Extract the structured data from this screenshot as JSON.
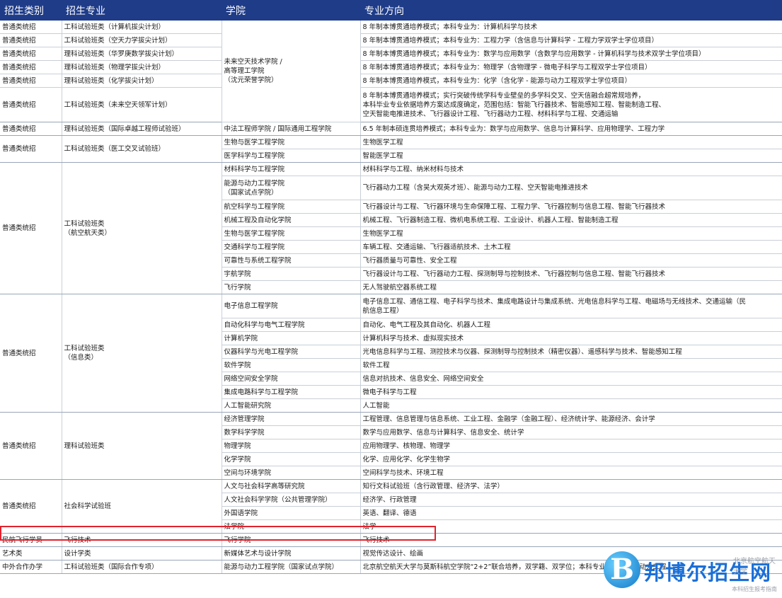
{
  "header": {
    "col1": "招生类别",
    "col2": "招生专业",
    "col3": "学院",
    "col4": "专业方向"
  },
  "rows": [
    {
      "cat": "普通类统招",
      "major": "工科试验班类（计算机拔尖计划）",
      "school": "未来空天技术学院 /\n高等理工学院\n（沈元荣誉学院）",
      "dir": "8 年制本博贯通培养模式；本科专业为：计算机科学与技术"
    },
    {
      "cat": "普通类统招",
      "major": "工科试验班类（空天力学拔尖计划）",
      "dir": "8 年制本博贯通培养模式；本科专业为：工程力学（含信息与计算科学 - 工程力学双学士学位项目）"
    },
    {
      "cat": "普通类统招",
      "major": "理科试验班类（华罗庚数学拔尖计划）",
      "dir": "8 年制本博贯通培养模式；本科专业为：数学与应用数学（含数学与应用数学 - 计算机科学与技术双学士学位项目）"
    },
    {
      "cat": "普通类统招",
      "major": "理科试验班类（物理学拔尖计划）",
      "dir": "8 年制本博贯通培养模式；本科专业为：物理学（含物理学 - 微电子科学与工程双学士学位项目）"
    },
    {
      "cat": "普通类统招",
      "major": "理科试验班类（化学拔尖计划）",
      "dir": "8 年制本博贯通培养模式，本科专业为：化学（含化学 - 能源与动力工程双学士学位项目）"
    },
    {
      "cat": "普通类统招",
      "major": "工科试验班类（未来空天领军计划）",
      "dir": "8 年制本博贯通培养模式；实行突破传统学科专业壁垒的多学科交叉、空天信融合超常规培养，\n本科毕业专业依据培养方案达成度确定，范围包括：智能飞行器技术、智能感知工程、智能制造工程、\n空天智能电推进技术、飞行器设计工程、飞行器动力工程、材料科学与工程、交通运输"
    },
    {
      "cat": "普通类统招",
      "major": "理科试验班类（国际卓越工程师试验班）",
      "school": "中法工程师学院 / 国际通用工程学院",
      "dir": "6.5 年制本硕连贯培养模式；本科专业为：数学与应用数学、信息与计算科学、应用物理学、工程力学"
    },
    {
      "cat": "普通类统招",
      "major": "工科试验班类（医工交叉试验班）",
      "school": "生物与医学工程学院",
      "dir": "生物医学工程"
    },
    {
      "school": "医学科学与工程学院",
      "dir": "智能医学工程"
    },
    {
      "cat": "普通类统招",
      "major": "工科试验班类\n（航空航天类）",
      "school": "材料科学与工程学院",
      "dir": "材料科学与工程、纳米材料与技术"
    },
    {
      "school": "能源与动力工程学院\n（国家试点学院）",
      "dir": "飞行器动力工程（含吴大观英才班）、能源与动力工程、空天智能电推进技术"
    },
    {
      "school": "航空科学与工程学院",
      "dir": "飞行器设计与工程、飞行器环境与生命保障工程、工程力学、飞行器控制与信息工程、智能飞行器技术"
    },
    {
      "school": "机械工程及自动化学院",
      "dir": "机械工程、飞行器制造工程、微机电系统工程、工业设计、机器人工程、智能制造工程"
    },
    {
      "school": "生物与医学工程学院",
      "dir": "生物医学工程"
    },
    {
      "school": "交通科学与工程学院",
      "dir": "车辆工程、交通运输、飞行器适航技术、土木工程"
    },
    {
      "school": "可靠性与系统工程学院",
      "dir": "飞行器质量与可靠性、安全工程"
    },
    {
      "school": "宇航学院",
      "dir": "飞行器设计与工程、飞行器动力工程、探测制导与控制技术、飞行器控制与信息工程、智能飞行器技术"
    },
    {
      "school": "飞行学院",
      "dir": "无人驾驶航空器系统工程"
    },
    {
      "cat": "普通类统招",
      "major": "工科试验班类\n（信息类）",
      "school": "电子信息工程学院",
      "dir": "电子信息工程、通信工程、电子科学与技术、集成电路设计与集成系统、光电信息科学与工程、电磁场与无线技术、交通运输（民\n航信息工程）"
    },
    {
      "school": "自动化科学与电气工程学院",
      "dir": "自动化、电气工程及其自动化、机器人工程"
    },
    {
      "school": "计算机学院",
      "dir": "计算机科学与技术、虚拟现实技术"
    },
    {
      "school": "仪器科学与光电工程学院",
      "dir": "光电信息科学与工程、测控技术与仪器、探测制导与控制技术（精密仪器）、遥感科学与技术、智能感知工程"
    },
    {
      "school": "软件学院",
      "dir": "软件工程"
    },
    {
      "school": "网络空间安全学院",
      "dir": "信息对抗技术、信息安全、网络空间安全"
    },
    {
      "school": "集成电路科学与工程学院",
      "dir": "微电子科学与工程"
    },
    {
      "school": "人工智能研究院",
      "dir": "人工智能"
    },
    {
      "cat": "普通类统招",
      "major": "理科试验班类",
      "school": "经济管理学院",
      "dir": "工程管理、信息管理与信息系统、工业工程、金融学（金融工程）、经济统计学、能源经济、会计学"
    },
    {
      "school": "数学科学学院",
      "dir": "数学与应用数学、信息与计算科学、信息安全、统计学"
    },
    {
      "school": "物理学院",
      "dir": "应用物理学、核物理、物理学"
    },
    {
      "school": "化学学院",
      "dir": "化学、应用化学、化学生物学"
    },
    {
      "school": "空间与环境学院",
      "dir": "空间科学与技术、环境工程"
    },
    {
      "cat": "普通类统招",
      "major": "社会科学试验班",
      "school": "人文与社会科学高等研究院",
      "dir": "知行文科试验班（含行政管理、经济学、法学）"
    },
    {
      "school": "人文社会科学学院（公共管理学院）",
      "dir": "经济学、行政管理"
    },
    {
      "school": "外国语学院",
      "dir": "英语、翻译、德语"
    },
    {
      "school": "法学院",
      "dir": "法学"
    },
    {
      "cat": "民航飞行学员",
      "major": "飞行技术",
      "school": "飞行学院",
      "dir": "飞行技术"
    },
    {
      "cat": "艺术类",
      "major": "设计学类",
      "school": "新媒体艺术与设计学院",
      "dir": "视觉传达设计、绘画"
    },
    {
      "cat": "中外合作办学",
      "major": "工科试验班类（国际合作专项）",
      "school": "能源与动力工程学院（国家试点学院）",
      "dir": "北京航空航天大学与莫斯科航空学院“2+2”联合培养，双学籍、双学位；本科专业为：飞行器动力工程"
    }
  ],
  "logo": {
    "letter": "B",
    "text": "邦博尔招生网",
    "watermark1": "北京航空航天大学",
    "watermark2": "本科招生报考指南"
  },
  "colors": {
    "header_bg": "#1f3c88",
    "highlight": "#e0232e"
  }
}
